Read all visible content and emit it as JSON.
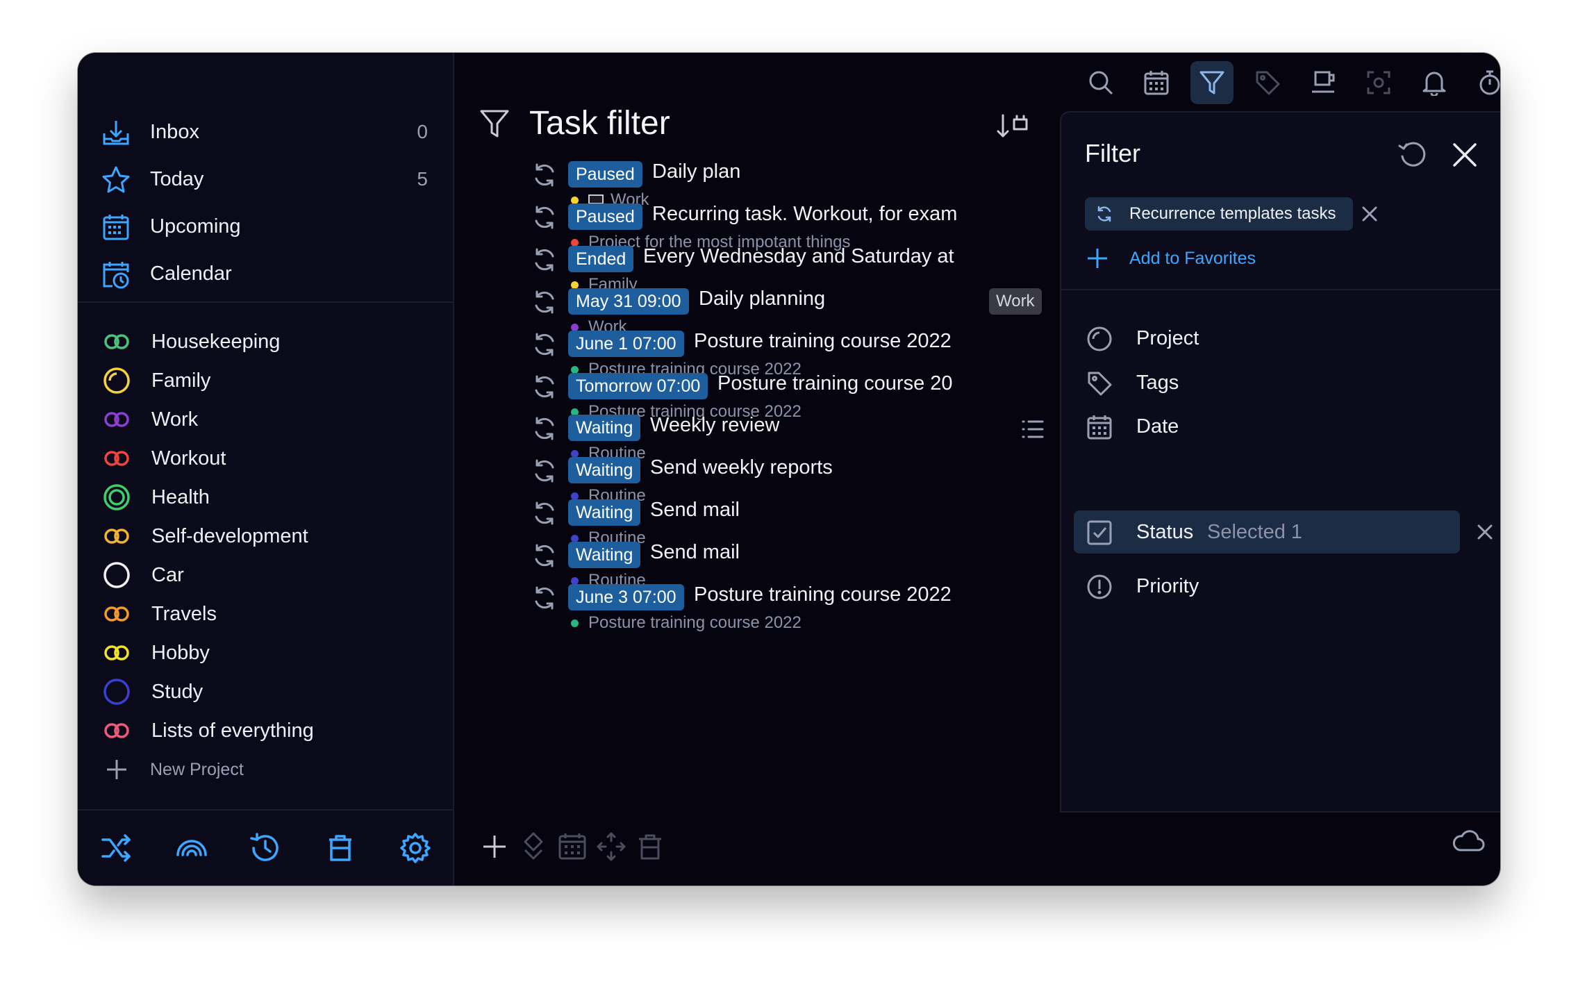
{
  "sidebar": {
    "nav": [
      {
        "label": "Inbox",
        "count": "0",
        "icon": "inbox-icon"
      },
      {
        "label": "Today",
        "count": "5",
        "icon": "star-icon"
      },
      {
        "label": "Upcoming",
        "count": "",
        "icon": "calendar-grid-icon"
      },
      {
        "label": "Calendar",
        "count": "",
        "icon": "calendar-clock-icon"
      }
    ],
    "projects": [
      {
        "label": "Housekeeping",
        "color": "#4cc37a",
        "icon": "double-ring-icon"
      },
      {
        "label": "Family",
        "color": "#f3d33c",
        "icon": "ring-icon"
      },
      {
        "label": "Work",
        "color": "#8a3fd1",
        "icon": "double-ring-icon"
      },
      {
        "label": "Workout",
        "color": "#f0453b",
        "icon": "double-ring-icon"
      },
      {
        "label": "Health",
        "color": "#3fcf6a",
        "icon": "concentric-ring-icon"
      },
      {
        "label": "Self-development",
        "color": "#f2b233",
        "icon": "double-ring-icon"
      },
      {
        "label": "Car",
        "color": "#f0f0f0",
        "icon": "ring-icon"
      },
      {
        "label": "Travels",
        "color": "#f39a2a",
        "icon": "double-ring-icon"
      },
      {
        "label": "Hobby",
        "color": "#f2e22c",
        "icon": "double-ring-icon"
      },
      {
        "label": "Study",
        "color": "#3b3fd0",
        "icon": "ring-icon"
      },
      {
        "label": "Lists of everything",
        "color": "#ef5a7a",
        "icon": "double-ring-icon"
      }
    ],
    "new_project": "New Project"
  },
  "main": {
    "title": "Task filter",
    "tasks": [
      {
        "badge": "Paused",
        "name": "Daily plan",
        "project": "Work",
        "dot": "#f5d431",
        "laptop": true
      },
      {
        "badge": "Paused",
        "name": "Recurring task. Workout, for exam",
        "project": "Project for the most impotant things",
        "dot": "#f0453b"
      },
      {
        "badge": "Ended",
        "name": "Every Wednesday and Saturday at",
        "project": "Family",
        "dot": "#f5d431"
      },
      {
        "badge": "May 31 09:00",
        "name": "Daily planning",
        "project": "Work",
        "dot": "#8a3fd1",
        "tag": "Work"
      },
      {
        "badge": "June 1 07:00",
        "name": "Posture training course 2022",
        "project": "Posture training course 2022",
        "dot": "#2bb583"
      },
      {
        "badge": "Tomorrow 07:00",
        "name": "Posture training course 20",
        "project": "Posture training course 2022",
        "dot": "#2bb583"
      },
      {
        "badge": "Waiting",
        "name": "Weekly review",
        "project": "Routine",
        "dot": "#4043c8",
        "note": true
      },
      {
        "badge": "Waiting",
        "name": "Send weekly reports",
        "project": "Routine",
        "dot": "#4043c8"
      },
      {
        "badge": "Waiting",
        "name": "Send mail",
        "project": "Routine",
        "dot": "#4043c8"
      },
      {
        "badge": "Waiting",
        "name": "Send mail",
        "project": "Routine",
        "dot": "#4043c8"
      },
      {
        "badge": "June 3 07:00",
        "name": "Posture training course 2022",
        "project": "Posture training course 2022",
        "dot": "#2bb583"
      }
    ]
  },
  "filter": {
    "title": "Filter",
    "chip_label": "Recurrence templates tasks",
    "add_favorites": "Add to Favorites",
    "rows": [
      {
        "label": "Project",
        "value": "",
        "icon": "project-ring-icon"
      },
      {
        "label": "Tags",
        "value": "",
        "icon": "tag-icon"
      },
      {
        "label": "Date",
        "value": "",
        "icon": "calendar-icon"
      },
      {
        "label": "Status",
        "value": "Selected 1",
        "icon": "checkbox-icon",
        "selected": true
      },
      {
        "label": "Priority",
        "value": "",
        "icon": "exclamation-circle-icon"
      }
    ]
  },
  "colors": {
    "accent": "#3da7ff",
    "badge": "#1f5e9c",
    "selected_row": "#1d2c45"
  }
}
